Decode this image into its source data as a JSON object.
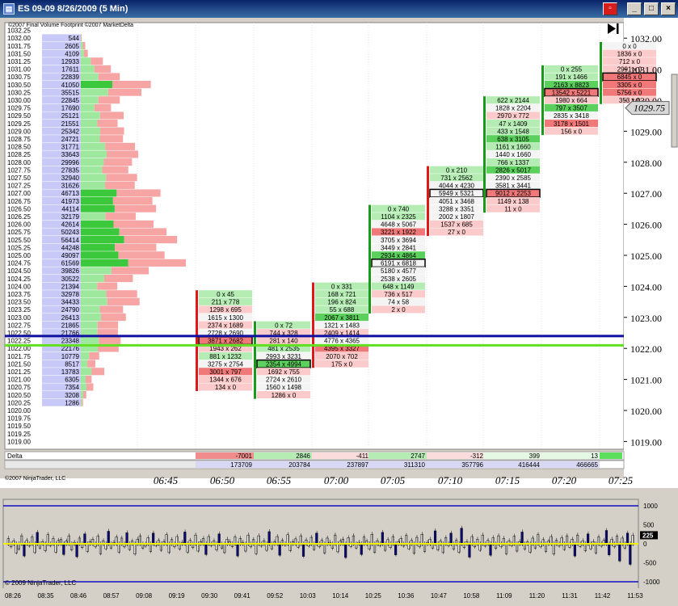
{
  "window": {
    "title": "ES 09-09  8/26/2009 (5 Min)",
    "icon": "chart-window-icon",
    "buttons": [
      "▫",
      "_",
      "□",
      "×"
    ]
  },
  "chart": {
    "header_copyright": "©2007 Final Volume Footprint ©2007 MarketDelta",
    "bottom_copyright": "©2007 NinjaTrader, LLC",
    "play_icon": "skip-to-end-icon",
    "current_price": "1029.75"
  },
  "chart_data": {
    "type": "footprint",
    "ylim": [
      1018.75,
      1032.5
    ],
    "price_axis_ticks": [
      "1032.00",
      "1031.00",
      "1030.00",
      "1029.00",
      "1028.00",
      "1027.00",
      "1026.00",
      "1025.00",
      "1024.00",
      "1023.00",
      "1022.00",
      "1021.00",
      "1020.00",
      "1019.00"
    ],
    "time_ticks": [
      "06:45",
      "06:50",
      "06:55",
      "07:00",
      "07:05",
      "07:10",
      "07:15",
      "07:20",
      "07:25"
    ],
    "volume_profile": [
      {
        "p": "1032.25",
        "v": ""
      },
      {
        "p": "1032.00",
        "v": "544"
      },
      {
        "p": "1031.75",
        "v": "2605"
      },
      {
        "p": "1031.50",
        "v": "4109"
      },
      {
        "p": "1031.25",
        "v": "12933"
      },
      {
        "p": "1031.00",
        "v": "17611"
      },
      {
        "p": "1030.75",
        "v": "22839"
      },
      {
        "p": "1030.50",
        "v": "41050"
      },
      {
        "p": "1030.25",
        "v": "35515"
      },
      {
        "p": "1030.00",
        "v": "22845"
      },
      {
        "p": "1029.75",
        "v": "17690"
      },
      {
        "p": "1029.50",
        "v": "25121"
      },
      {
        "p": "1029.25",
        "v": "21551"
      },
      {
        "p": "1029.00",
        "v": "25342"
      },
      {
        "p": "1028.75",
        "v": "24721"
      },
      {
        "p": "1028.50",
        "v": "31771"
      },
      {
        "p": "1028.25",
        "v": "33643"
      },
      {
        "p": "1028.00",
        "v": "29996"
      },
      {
        "p": "1027.75",
        "v": "27835"
      },
      {
        "p": "1027.50",
        "v": "32940"
      },
      {
        "p": "1027.25",
        "v": "31626"
      },
      {
        "p": "1027.00",
        "v": "46713"
      },
      {
        "p": "1026.75",
        "v": "41973"
      },
      {
        "p": "1026.50",
        "v": "44114"
      },
      {
        "p": "1026.25",
        "v": "32179"
      },
      {
        "p": "1026.00",
        "v": "42614"
      },
      {
        "p": "1025.75",
        "v": "50243"
      },
      {
        "p": "1025.50",
        "v": "56414"
      },
      {
        "p": "1025.25",
        "v": "44248"
      },
      {
        "p": "1025.00",
        "v": "49097"
      },
      {
        "p": "1024.75",
        "v": "61569"
      },
      {
        "p": "1024.50",
        "v": "39826"
      },
      {
        "p": "1024.25",
        "v": "30522"
      },
      {
        "p": "1024.00",
        "v": "21394"
      },
      {
        "p": "1023.75",
        "v": "32978"
      },
      {
        "p": "1023.50",
        "v": "34433"
      },
      {
        "p": "1023.25",
        "v": "24790"
      },
      {
        "p": "1023.00",
        "v": "26413"
      },
      {
        "p": "1022.75",
        "v": "21865"
      },
      {
        "p": "1022.50",
        "v": "21766"
      },
      {
        "p": "1022.25",
        "v": "23348"
      },
      {
        "p": "1022.00",
        "v": "22176"
      },
      {
        "p": "1021.75",
        "v": "10779"
      },
      {
        "p": "1021.50",
        "v": "8517"
      },
      {
        "p": "1021.25",
        "v": "13783"
      },
      {
        "p": "1021.00",
        "v": "6305"
      },
      {
        "p": "1020.75",
        "v": "7354"
      },
      {
        "p": "1020.50",
        "v": "3208"
      },
      {
        "p": "1020.25",
        "v": "1286"
      },
      {
        "p": "1020.00",
        "v": ""
      },
      {
        "p": "1019.75",
        "v": ""
      },
      {
        "p": "1019.50",
        "v": ""
      },
      {
        "p": "1019.25",
        "v": ""
      },
      {
        "p": "1019.00",
        "v": ""
      }
    ],
    "bars": [
      {
        "time": "06:50",
        "top": 1023.75,
        "cells": [
          "0 x 45",
          "211 x 778",
          "1298 x 695",
          "1615 x 1300",
          "2374 x 1689",
          "2728 x 2690",
          "3871 x 2682",
          "1943 x 262",
          "881 x 1232",
          "3275 x 2754",
          "3001 x 797",
          "1344 x 676",
          "134 x 0"
        ],
        "boxed": 6,
        "delta": "-7001",
        "cum": "173709"
      },
      {
        "time": "06:55",
        "top": 1022.75,
        "cells": [
          "0 x 72",
          "744 x 328",
          "281 x 140",
          "481 x 2535",
          "2993 x 3231",
          "2354 x 4994",
          "1692 x 755",
          "2724 x 2610",
          "1560 x 1498",
          "1286 x 0"
        ],
        "boxed": 5,
        "delta": "2846",
        "cum": "203784"
      },
      {
        "time": "07:00",
        "top": 1024.0,
        "cells": [
          "0 x 331",
          "168 x 721",
          "196 x 824",
          "55 x 688",
          "2067 x 3811",
          "1321 x 1483",
          "2409 x 1414",
          "4776 x 4365",
          "4395 x 3327",
          "2070 x 702",
          "175 x 0"
        ],
        "boxed": -1,
        "delta": "-411",
        "cum": "237897"
      },
      {
        "time": "07:05",
        "top": 1026.5,
        "cells": [
          "0 x 740",
          "1104 x 2325",
          "4648 x 5067",
          "3221 x 1922",
          "3705 x 3694",
          "3449 x 2841",
          "2934 x 4864",
          "6191 x 6818",
          "5180 x 4577",
          "2538 x 2605",
          "648 x 1149",
          "736 x 517",
          "74 x 58",
          "2 x 0"
        ],
        "boxed": 7,
        "delta": "2747",
        "cum": "311310"
      },
      {
        "time": "07:10",
        "top": 1027.75,
        "cells": [
          "0 x 210",
          "731 x 2562",
          "4044 x 4230",
          "5949 x 5321",
          "4051 x 3468",
          "3288 x 3351",
          "2002 x 1807",
          "1537 x 685",
          "27 x 0"
        ],
        "boxed": 3,
        "delta": "-312",
        "cum": "357796"
      },
      {
        "time": "07:15",
        "top": 1030.0,
        "cells": [
          "622 x 2144",
          "1828 x 2204",
          "2970 x 772",
          "47 x 1409",
          "433 x 1548",
          "638 x 3105",
          "1161 x 1660",
          "1440 x 1660",
          "766 x 1337",
          "2826 x 5017",
          "2390 x 2585",
          "3581 x 3441",
          "9012 x 2253",
          "1149 x 138",
          "11 x 0"
        ],
        "boxed": 12,
        "delta": "399",
        "cum": "416444"
      },
      {
        "time": "07:20",
        "top": 1031.0,
        "cells": [
          "0 x 255",
          "191 x 1466",
          "2163 x 8823",
          "13542 x 5221",
          "1980 x 664",
          "797 x 3507",
          "2835 x 3418",
          "3178 x 1501",
          "156 x 0"
        ],
        "boxed": 3,
        "delta": "13",
        "cum": "466665"
      },
      {
        "time": "07:25",
        "top": 1031.75,
        "cells": [
          "0 x 0",
          "1836 x 0",
          "712 x 0",
          "2991 x 0",
          "6845 x 0",
          "3305 x 0",
          "5756 x 0",
          "353 x 0"
        ],
        "boxed": 4,
        "delta": "",
        "cum": ""
      }
    ],
    "delta_label": "Delta",
    "cum_label": "Cum. Volume"
  },
  "indicator": {
    "copyright": "© 2009 NinjaTrader, LLC",
    "ticks": [
      "1000",
      "500",
      "0",
      "-500",
      "-1000"
    ],
    "current_value": "225",
    "time_ticks": [
      "08:26",
      "08:35",
      "08:46",
      "08:57",
      "09:08",
      "09:19",
      "09:30",
      "09:41",
      "09:52",
      "10:03",
      "10:14",
      "10:25",
      "10:36",
      "10:47",
      "10:58",
      "11:09",
      "11:20",
      "11:31",
      "11:42",
      "11:53"
    ],
    "ylim": [
      -1000,
      1000
    ],
    "series": [
      140,
      -60,
      80,
      -220,
      -120,
      210,
      -300,
      90,
      -40,
      180,
      -210,
      300,
      -90,
      60,
      -160,
      240,
      -30,
      140,
      -200,
      90,
      110,
      -260,
      70,
      210,
      -140,
      40,
      -320,
      150,
      -80,
      260,
      -180,
      60,
      120,
      -60,
      200,
      -240,
      80,
      -110,
      330,
      -90,
      40,
      180,
      -200,
      150,
      -60,
      290,
      -130,
      70,
      -250,
      120,
      210,
      -90,
      -40,
      160,
      -180,
      280,
      -30,
      90,
      -150,
      60,
      240,
      -210,
      110,
      -60,
      190,
      -120,
      40,
      310,
      -200,
      90,
      -80,
      230,
      -170,
      60,
      140,
      -260,
      190,
      -30,
      80,
      -140,
      260,
      -90,
      -210,
      120,
      60,
      -50,
      180,
      -300,
      140,
      40,
      -170,
      230,
      -60,
      110,
      -240,
      210,
      -40,
      80,
      -150,
      320,
      -110,
      50,
      190,
      -280,
      90,
      -20,
      240,
      -160,
      60,
      130,
      -70,
      210,
      -310,
      100,
      -40,
      170,
      -130,
      280,
      -60,
      90,
      -220,
      150,
      40,
      -100,
      230,
      -190,
      70,
      120,
      -340,
      160,
      -50,
      210,
      -90,
      40,
      -260,
      180,
      70,
      -120,
      250,
      -200,
      80,
      -30,
      300,
      -150,
      110,
      -80,
      190,
      -270,
      60,
      140,
      -40,
      220,
      -110,
      90,
      -230,
      170,
      -60,
      250,
      -180,
      40,
      120,
      -90,
      340,
      -140,
      70,
      -210,
      160,
      -30,
      280,
      -120,
      90,
      -200,
      410,
      -80,
      60,
      -330,
      190,
      -60,
      120,
      -150,
      230,
      -40,
      90,
      -280,
      160,
      -100,
      210,
      -60,
      140,
      -240,
      80,
      -30,
      200,
      -170,
      60,
      310,
      -120,
      50,
      -200,
      150,
      -90,
      240,
      -60,
      110,
      -180,
      70,
      190,
      -250,
      90,
      -40,
      160,
      -130,
      210,
      -70,
      120,
      -300,
      230,
      -50,
      80,
      -160,
      260,
      -110,
      60,
      -220,
      180,
      -40,
      90,
      350,
      -270,
      120,
      -60,
      200,
      -430,
      150,
      -90,
      280,
      -520,
      225
    ]
  }
}
